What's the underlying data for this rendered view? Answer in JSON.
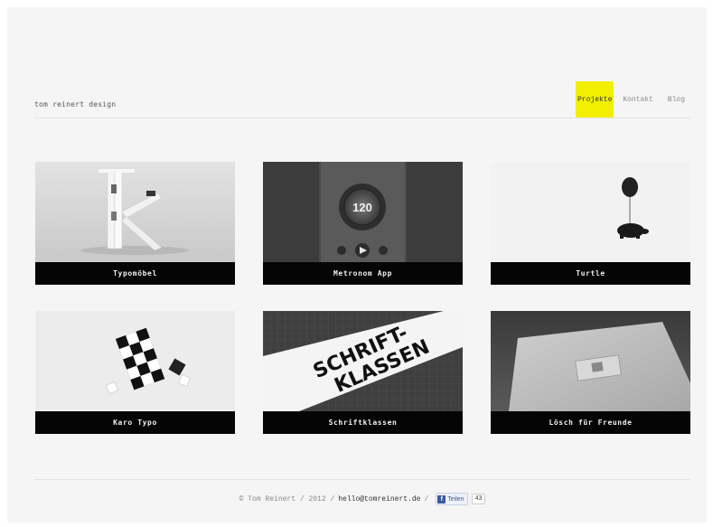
{
  "header": {
    "brand": "tom reinert design",
    "nav": [
      {
        "label": "Projekte",
        "active": true
      },
      {
        "label": "Kontakt",
        "active": false
      },
      {
        "label": "Blog",
        "active": false
      }
    ]
  },
  "projects": [
    {
      "title": "Typomöbel"
    },
    {
      "title": "Metronom App",
      "display_value": "120"
    },
    {
      "title": "Turtle"
    },
    {
      "title": "Karo Typo"
    },
    {
      "title": "Schriftklassen",
      "sign_line1": "SCHRIFT-",
      "sign_line2": "KLASSEN"
    },
    {
      "title": "Lösch für Freunde"
    }
  ],
  "footer": {
    "copyright": "© Tom Reinert / 2012 / ",
    "email": "hello@tomreinert.de",
    "separator": " / ",
    "like_label": "Teilen",
    "like_count": "43"
  }
}
